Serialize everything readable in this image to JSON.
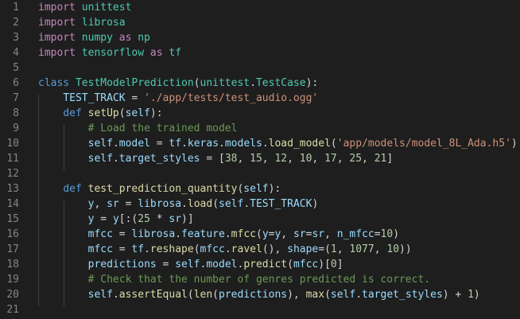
{
  "editor": {
    "language": "python",
    "theme": "dark",
    "colors": {
      "background": "#1e1e1e",
      "line_number": "#858585",
      "keyword": "#c586c0",
      "definition": "#569cd6",
      "class_name": "#4ec9b0",
      "function": "#dcdcaa",
      "variable": "#9cdcfe",
      "string": "#ce9178",
      "number": "#b5cea8",
      "comment": "#6a9955",
      "text": "#d4d4d4"
    },
    "lines": [
      {
        "number": "1",
        "tokens": [
          [
            "kw",
            "import"
          ],
          [
            "txt",
            " "
          ],
          [
            "cls",
            "unittest"
          ]
        ]
      },
      {
        "number": "2",
        "tokens": [
          [
            "kw",
            "import"
          ],
          [
            "txt",
            " "
          ],
          [
            "cls",
            "librosa"
          ]
        ]
      },
      {
        "number": "3",
        "tokens": [
          [
            "kw",
            "import"
          ],
          [
            "txt",
            " "
          ],
          [
            "cls",
            "numpy"
          ],
          [
            "txt",
            " "
          ],
          [
            "kw",
            "as"
          ],
          [
            "txt",
            " "
          ],
          [
            "cls",
            "np"
          ]
        ]
      },
      {
        "number": "4",
        "tokens": [
          [
            "kw",
            "import"
          ],
          [
            "txt",
            " "
          ],
          [
            "cls",
            "tensorflow"
          ],
          [
            "txt",
            " "
          ],
          [
            "kw",
            "as"
          ],
          [
            "txt",
            " "
          ],
          [
            "cls",
            "tf"
          ]
        ]
      },
      {
        "number": "5",
        "tokens": []
      },
      {
        "number": "6",
        "tokens": [
          [
            "def",
            "class"
          ],
          [
            "txt",
            " "
          ],
          [
            "cls",
            "TestModelPrediction"
          ],
          [
            "txt",
            "("
          ],
          [
            "cls",
            "unittest"
          ],
          [
            "txt",
            "."
          ],
          [
            "cls",
            "TestCase"
          ],
          [
            "txt",
            "):"
          ]
        ]
      },
      {
        "number": "7",
        "tokens": [
          [
            "txt",
            "    "
          ],
          [
            "var",
            "TEST_TRACK"
          ],
          [
            "txt",
            " = "
          ],
          [
            "str",
            "'./app/tests/test_audio.ogg'"
          ]
        ]
      },
      {
        "number": "8",
        "tokens": [
          [
            "txt",
            "    "
          ],
          [
            "def",
            "def"
          ],
          [
            "txt",
            " "
          ],
          [
            "fn",
            "setUp"
          ],
          [
            "txt",
            "("
          ],
          [
            "var",
            "self"
          ],
          [
            "txt",
            "):"
          ]
        ]
      },
      {
        "number": "9",
        "tokens": [
          [
            "txt",
            "        "
          ],
          [
            "cmt",
            "# Load the trained model"
          ]
        ]
      },
      {
        "number": "10",
        "tokens": [
          [
            "txt",
            "        "
          ],
          [
            "var",
            "self"
          ],
          [
            "txt",
            "."
          ],
          [
            "var",
            "model"
          ],
          [
            "txt",
            " = "
          ],
          [
            "var",
            "tf"
          ],
          [
            "txt",
            "."
          ],
          [
            "var",
            "keras"
          ],
          [
            "txt",
            "."
          ],
          [
            "var",
            "models"
          ],
          [
            "txt",
            "."
          ],
          [
            "fn",
            "load_model"
          ],
          [
            "txt",
            "("
          ],
          [
            "str",
            "'app/models/model_8L_Ada.h5'"
          ],
          [
            "txt",
            ")"
          ]
        ]
      },
      {
        "number": "11",
        "tokens": [
          [
            "txt",
            "        "
          ],
          [
            "var",
            "self"
          ],
          [
            "txt",
            "."
          ],
          [
            "var",
            "target_styles"
          ],
          [
            "txt",
            " = ["
          ],
          [
            "num",
            "38"
          ],
          [
            "txt",
            ", "
          ],
          [
            "num",
            "15"
          ],
          [
            "txt",
            ", "
          ],
          [
            "num",
            "12"
          ],
          [
            "txt",
            ", "
          ],
          [
            "num",
            "10"
          ],
          [
            "txt",
            ", "
          ],
          [
            "num",
            "17"
          ],
          [
            "txt",
            ", "
          ],
          [
            "num",
            "25"
          ],
          [
            "txt",
            ", "
          ],
          [
            "num",
            "21"
          ],
          [
            "txt",
            "]"
          ]
        ]
      },
      {
        "number": "12",
        "tokens": []
      },
      {
        "number": "13",
        "tokens": [
          [
            "txt",
            "    "
          ],
          [
            "def",
            "def"
          ],
          [
            "txt",
            " "
          ],
          [
            "fn",
            "test_prediction_quantity"
          ],
          [
            "txt",
            "("
          ],
          [
            "var",
            "self"
          ],
          [
            "txt",
            "):"
          ]
        ]
      },
      {
        "number": "14",
        "tokens": [
          [
            "txt",
            "        "
          ],
          [
            "var",
            "y"
          ],
          [
            "txt",
            ", "
          ],
          [
            "var",
            "sr"
          ],
          [
            "txt",
            " = "
          ],
          [
            "var",
            "librosa"
          ],
          [
            "txt",
            "."
          ],
          [
            "fn",
            "load"
          ],
          [
            "txt",
            "("
          ],
          [
            "var",
            "self"
          ],
          [
            "txt",
            "."
          ],
          [
            "var",
            "TEST_TRACK"
          ],
          [
            "txt",
            ")"
          ]
        ]
      },
      {
        "number": "15",
        "tokens": [
          [
            "txt",
            "        "
          ],
          [
            "var",
            "y"
          ],
          [
            "txt",
            " = "
          ],
          [
            "var",
            "y"
          ],
          [
            "txt",
            "[:("
          ],
          [
            "num",
            "25"
          ],
          [
            "txt",
            " * "
          ],
          [
            "var",
            "sr"
          ],
          [
            "txt",
            ")]"
          ]
        ]
      },
      {
        "number": "16",
        "tokens": [
          [
            "txt",
            "        "
          ],
          [
            "var",
            "mfcc"
          ],
          [
            "txt",
            " = "
          ],
          [
            "var",
            "librosa"
          ],
          [
            "txt",
            "."
          ],
          [
            "var",
            "feature"
          ],
          [
            "txt",
            "."
          ],
          [
            "fn",
            "mfcc"
          ],
          [
            "txt",
            "("
          ],
          [
            "var",
            "y"
          ],
          [
            "txt",
            "="
          ],
          [
            "var",
            "y"
          ],
          [
            "txt",
            ", "
          ],
          [
            "var",
            "sr"
          ],
          [
            "txt",
            "="
          ],
          [
            "var",
            "sr"
          ],
          [
            "txt",
            ", "
          ],
          [
            "var",
            "n_mfcc"
          ],
          [
            "txt",
            "="
          ],
          [
            "num",
            "10"
          ],
          [
            "txt",
            ")"
          ]
        ]
      },
      {
        "number": "17",
        "tokens": [
          [
            "txt",
            "        "
          ],
          [
            "var",
            "mfcc"
          ],
          [
            "txt",
            " = "
          ],
          [
            "var",
            "tf"
          ],
          [
            "txt",
            "."
          ],
          [
            "fn",
            "reshape"
          ],
          [
            "txt",
            "("
          ],
          [
            "var",
            "mfcc"
          ],
          [
            "txt",
            "."
          ],
          [
            "fn",
            "ravel"
          ],
          [
            "txt",
            "(), "
          ],
          [
            "var",
            "shape"
          ],
          [
            "txt",
            "=("
          ],
          [
            "num",
            "1"
          ],
          [
            "txt",
            ", "
          ],
          [
            "num",
            "1077"
          ],
          [
            "txt",
            ", "
          ],
          [
            "num",
            "10"
          ],
          [
            "txt",
            "))"
          ]
        ]
      },
      {
        "number": "18",
        "tokens": [
          [
            "txt",
            "        "
          ],
          [
            "var",
            "predictions"
          ],
          [
            "txt",
            " = "
          ],
          [
            "var",
            "self"
          ],
          [
            "txt",
            "."
          ],
          [
            "var",
            "model"
          ],
          [
            "txt",
            "."
          ],
          [
            "fn",
            "predict"
          ],
          [
            "txt",
            "("
          ],
          [
            "var",
            "mfcc"
          ],
          [
            "txt",
            ")["
          ],
          [
            "num",
            "0"
          ],
          [
            "txt",
            "]"
          ]
        ]
      },
      {
        "number": "19",
        "tokens": [
          [
            "txt",
            "        "
          ],
          [
            "cmt",
            "# Check that the number of genres predicted is correct."
          ]
        ]
      },
      {
        "number": "20",
        "tokens": [
          [
            "txt",
            "        "
          ],
          [
            "var",
            "self"
          ],
          [
            "txt",
            "."
          ],
          [
            "fn",
            "assertEqual"
          ],
          [
            "txt",
            "("
          ],
          [
            "fn",
            "len"
          ],
          [
            "txt",
            "("
          ],
          [
            "var",
            "predictions"
          ],
          [
            "txt",
            "), "
          ],
          [
            "fn",
            "max"
          ],
          [
            "txt",
            "("
          ],
          [
            "var",
            "self"
          ],
          [
            "txt",
            "."
          ],
          [
            "var",
            "target_styles"
          ],
          [
            "txt",
            ") + "
          ],
          [
            "num",
            "1"
          ],
          [
            "txt",
            ")"
          ]
        ]
      },
      {
        "number": "21",
        "tokens": []
      }
    ]
  }
}
